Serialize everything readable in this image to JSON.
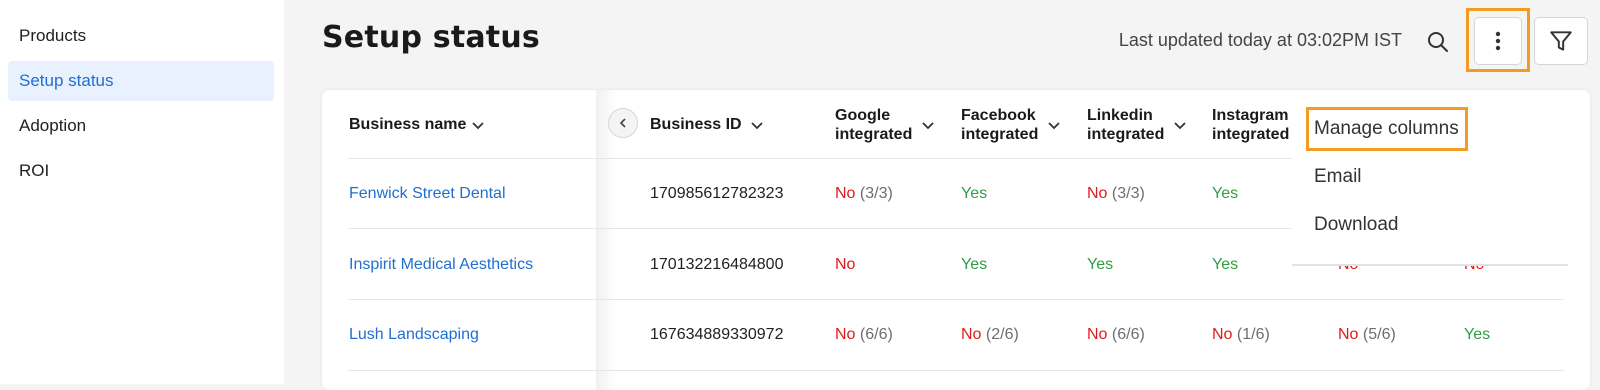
{
  "sidebar": {
    "items": [
      {
        "label": "Products",
        "active": false
      },
      {
        "label": "Setup status",
        "active": true
      },
      {
        "label": "Adoption",
        "active": false
      },
      {
        "label": "ROI",
        "active": false
      }
    ]
  },
  "header": {
    "title": "Setup status",
    "last_updated": "Last updated today at 03:02PM IST",
    "icons": {
      "search": "search-icon",
      "more": "more-vert-icon",
      "filter": "filter-icon"
    }
  },
  "table": {
    "columns": [
      {
        "line1": "Business name",
        "line2": ""
      },
      {
        "line1": "Business ID",
        "line2": ""
      },
      {
        "line1": "Google",
        "line2": "integrated"
      },
      {
        "line1": "Facebook",
        "line2": "integrated"
      },
      {
        "line1": "Linkedin",
        "line2": "integrated"
      },
      {
        "line1": "Instagram",
        "line2": "integrated"
      }
    ],
    "rows": [
      {
        "name": "Fenwick Street Dental",
        "id": "170985612782323",
        "google": {
          "status": "No",
          "detail": "(3/3)"
        },
        "facebook": {
          "status": "Yes",
          "detail": ""
        },
        "linkedin": {
          "status": "No",
          "detail": "(3/3)"
        },
        "instagram": {
          "status": "Yes",
          "detail": ""
        }
      },
      {
        "name": "Inspirit Medical Aesthetics",
        "id": "170132216484800",
        "google": {
          "status": "No",
          "detail": ""
        },
        "facebook": {
          "status": "Yes",
          "detail": ""
        },
        "linkedin": {
          "status": "Yes",
          "detail": ""
        },
        "instagram": {
          "status": "Yes",
          "detail": ""
        },
        "col7": {
          "status": "No",
          "detail": ""
        },
        "col8": {
          "status": "No",
          "detail": ""
        }
      },
      {
        "name": "Lush Landscaping",
        "id": "167634889330972",
        "google": {
          "status": "No",
          "detail": "(6/6)"
        },
        "facebook": {
          "status": "No",
          "detail": "(2/6)"
        },
        "linkedin": {
          "status": "No",
          "detail": "(6/6)"
        },
        "instagram": {
          "status": "No",
          "detail": "(1/6)"
        },
        "col7": {
          "status": "No",
          "detail": "(5/6)"
        },
        "col8": {
          "status": "Yes",
          "detail": ""
        }
      }
    ]
  },
  "menu": {
    "items": [
      "Manage columns",
      "Email",
      "Download"
    ],
    "highlighted": "Manage columns"
  },
  "colors": {
    "accent": "#1f6fd1",
    "no": "#e01b1b",
    "yes": "#2f9e44",
    "highlight": "#f59a23",
    "sidebar_active_bg": "#e8f1fd"
  }
}
